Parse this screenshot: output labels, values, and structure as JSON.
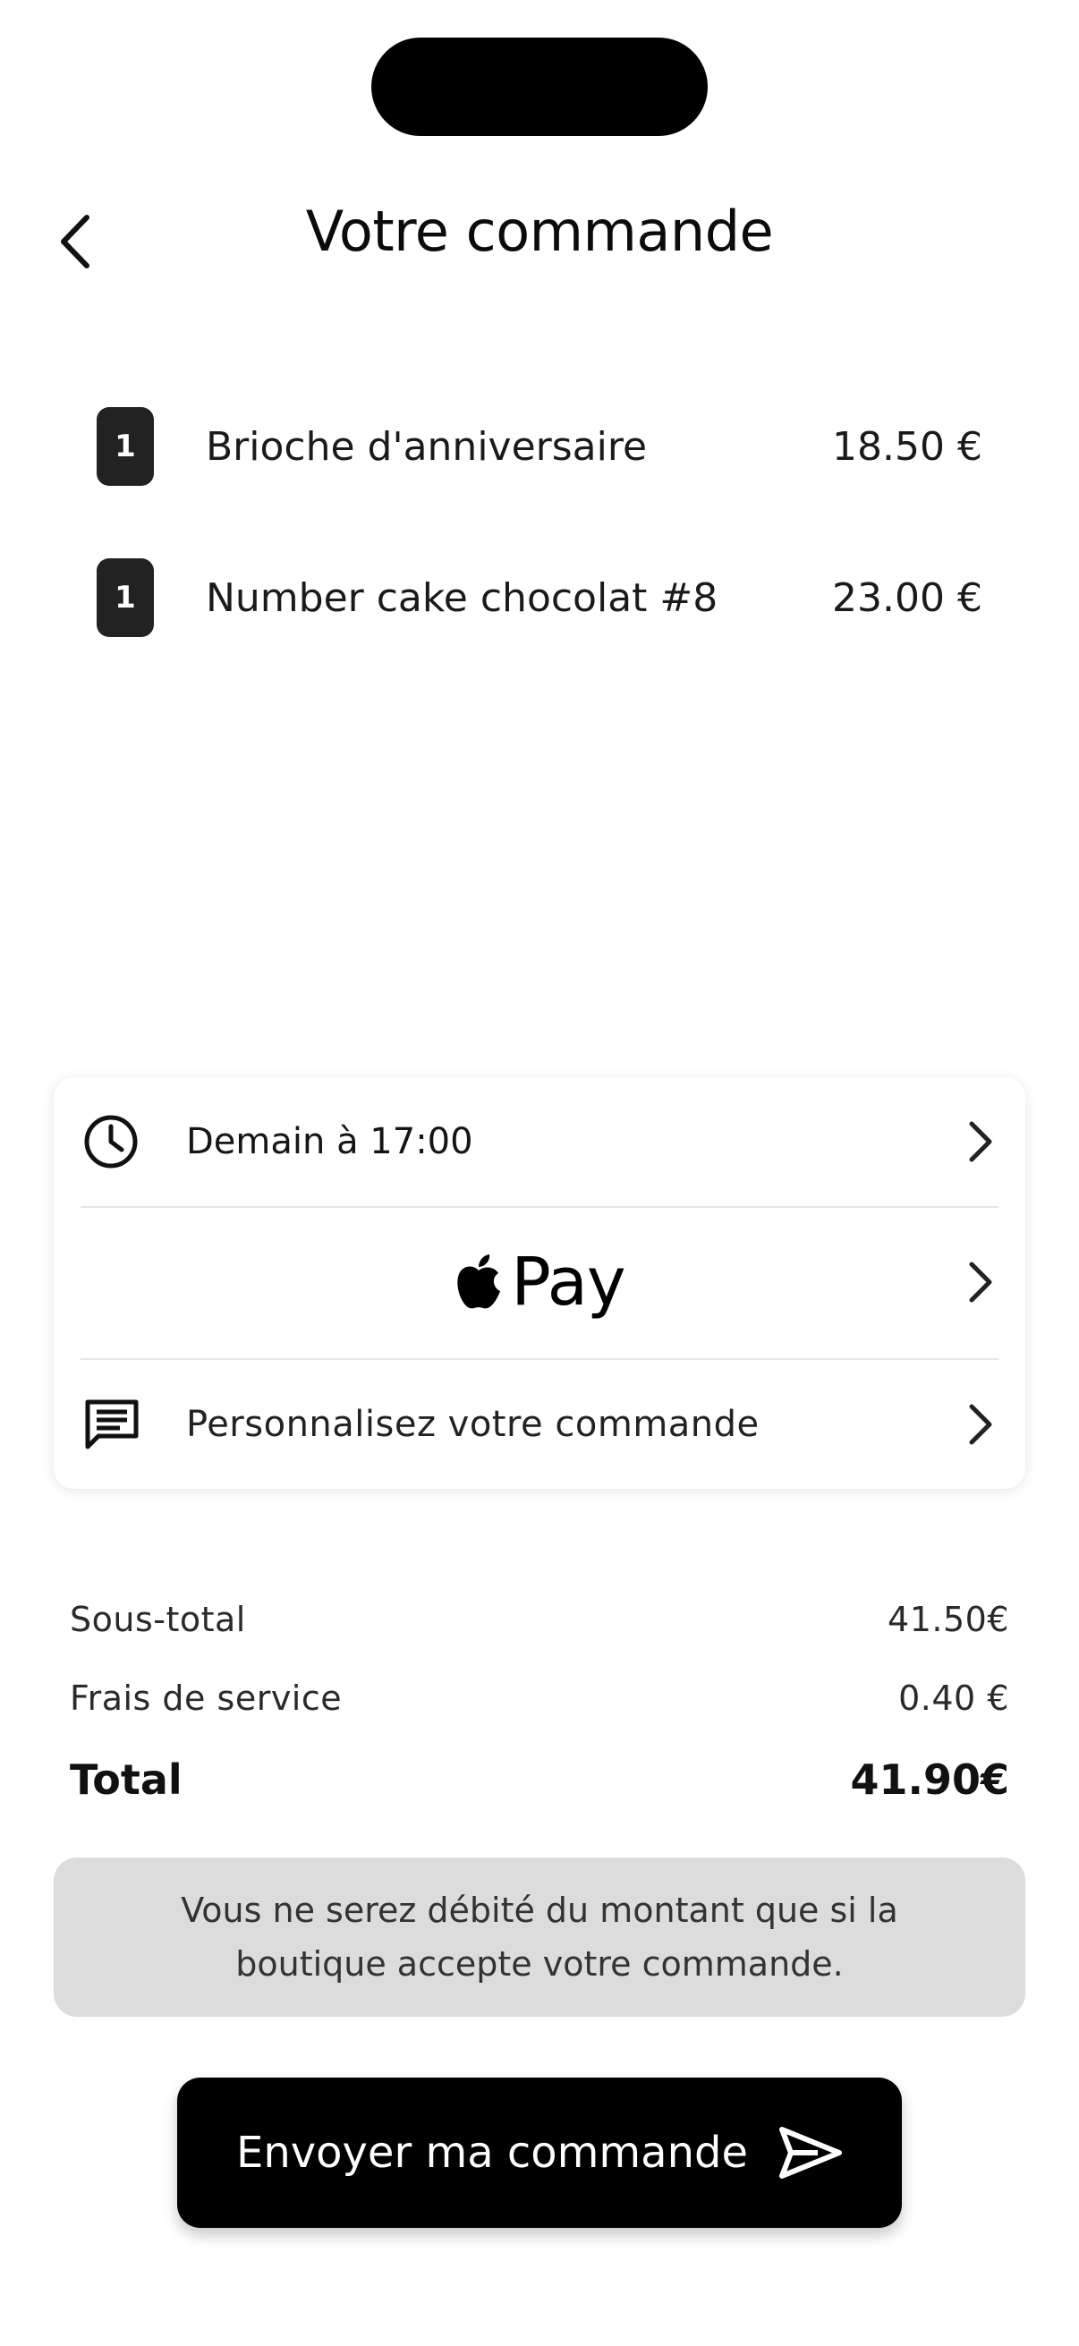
{
  "header": {
    "title": "Votre commande",
    "back_icon": "chevron-left-icon"
  },
  "items": [
    {
      "qty": "1",
      "name": "Brioche d'anniversaire",
      "price": "18.50 €"
    },
    {
      "qty": "1",
      "name": "Number cake chocolat #8",
      "price": "23.00 €"
    }
  ],
  "options": {
    "pickup": {
      "icon": "clock-icon",
      "label": "Demain à 17:00"
    },
    "payment": {
      "icon": "apple-logo-icon",
      "label": "Pay"
    },
    "customize": {
      "icon": "message-icon",
      "label": "Personnalisez votre commande"
    },
    "chevron_icon": "chevron-right-icon"
  },
  "summary": {
    "subtotal_label": "Sous-total",
    "subtotal_value": "41.50€",
    "fees_label": "Frais de service",
    "fees_value": "0.40 €",
    "total_label": "Total",
    "total_value": "41.90€"
  },
  "notice": "Vous ne serez débité du montant que si la boutique accepte votre commande.",
  "cta": {
    "label": "Envoyer ma commande",
    "icon": "send-icon"
  }
}
